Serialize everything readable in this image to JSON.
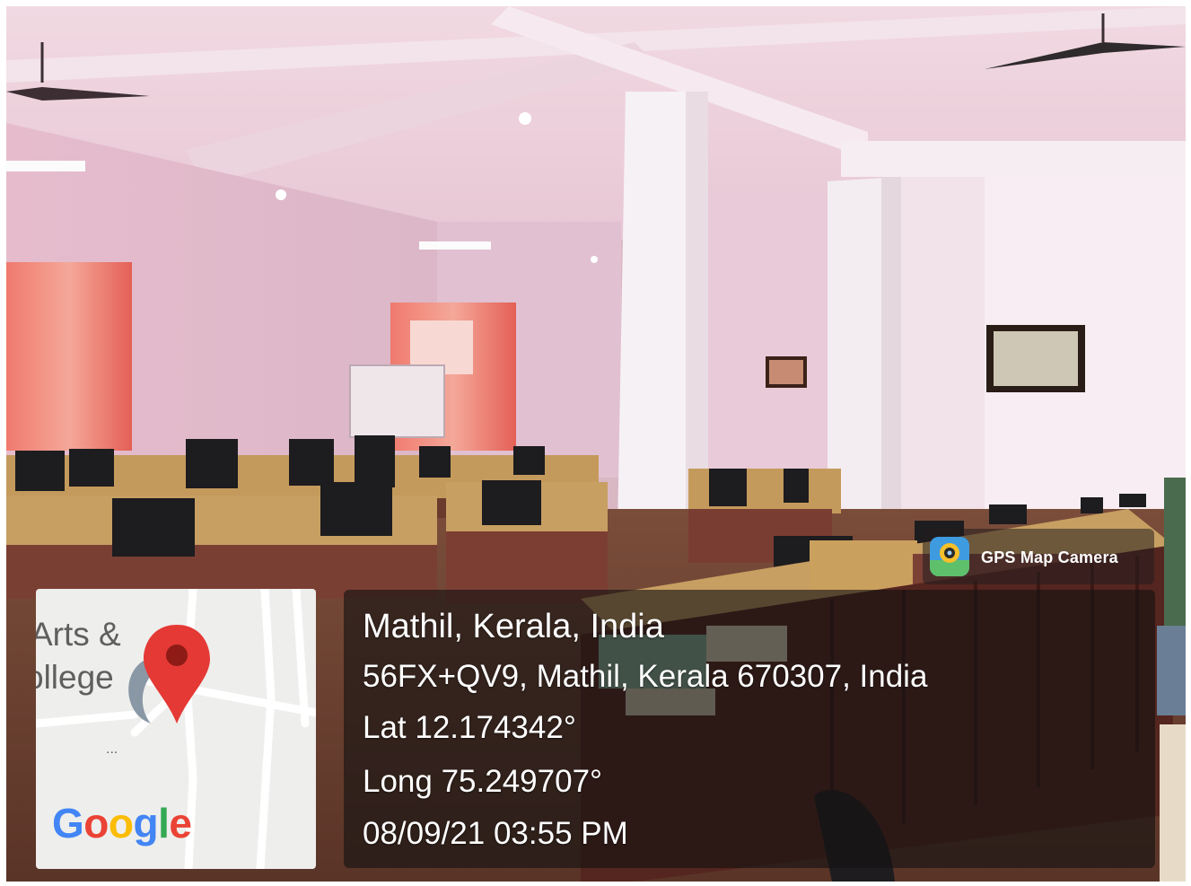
{
  "badge": {
    "label": "GPS Map Camera",
    "icon": "gps-map-camera-app-icon"
  },
  "location": {
    "title": "Mathil, Kerala, India",
    "address": "56FX+QV9, Mathil, Kerala 670307, India",
    "latitude": "Lat 12.174342°",
    "longitude": "Long 75.249707°",
    "datetime": "08/09/21 03:55 PM"
  },
  "map": {
    "label_line_1": "Arts &",
    "label_line_2": "ollege",
    "ellipsis": "...",
    "marker_icon": "map-pin-icon",
    "marker_color": "#e53935",
    "provider": {
      "letters": [
        "G",
        "o",
        "o",
        "g",
        "l",
        "e"
      ],
      "colors": [
        "#4285F4",
        "#EA4335",
        "#FBBC05",
        "#4285F4",
        "#34A853",
        "#EA4335"
      ]
    }
  },
  "colors": {
    "panel_bg": "rgba(20,18,18,0.62)",
    "text": "#ffffff",
    "wall": "#e6c9d6",
    "curtain": "#e8574f",
    "wood": "#b88a4a"
  }
}
